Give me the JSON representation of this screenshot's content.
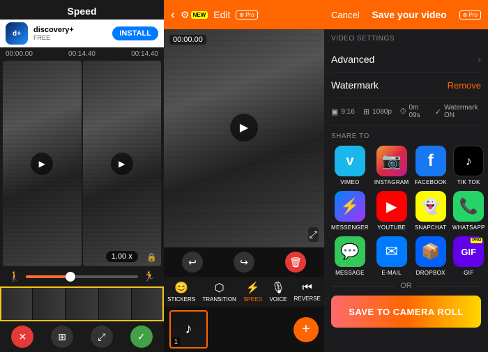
{
  "left": {
    "title": "Speed",
    "ad": {
      "app_name": "discovery+",
      "subtitle": "FREE",
      "install_label": "INSTALL"
    },
    "timeline": {
      "start": "00:00.00",
      "mid": "00:14.40",
      "end": "00:14.40"
    },
    "speed_value": "1.00 x",
    "controls": {
      "undo": "↩",
      "redo": "↪",
      "delete": "🗑",
      "cancel": "✕",
      "confirm": "✓"
    }
  },
  "middle": {
    "nav": {
      "edit_label": "Edit",
      "new_badge": "NEW",
      "pro_label": "⊕ Pro"
    },
    "video": {
      "timestamp": "00:00.00"
    },
    "tools": [
      {
        "id": "stickers",
        "icon": "😊",
        "label": "STICKERS"
      },
      {
        "id": "transition",
        "icon": "⬡",
        "label": "TRANSITION"
      },
      {
        "id": "speed",
        "icon": "🏃",
        "label": "SPEED",
        "active": true
      },
      {
        "id": "voice",
        "icon": "🎙",
        "label": "VOICE"
      },
      {
        "id": "reverse",
        "icon": "⏮",
        "label": "REVERSE"
      }
    ],
    "add_label": "+"
  },
  "right": {
    "nav": {
      "cancel_label": "Cancel",
      "title": "Save your video",
      "pro_badge": "⊕ Pro"
    },
    "video_settings_label": "VIDEO SETTINGS",
    "advanced_label": "Advanced",
    "watermark_label": "Watermark",
    "remove_label": "Remove",
    "meta": {
      "ratio": "9:16",
      "resolution": "1080p",
      "duration": "0m 09s",
      "watermark_on": "Watermark ON"
    },
    "share_to_label": "SHARE TO",
    "share_items": [
      {
        "id": "vimeo",
        "label": "VIMEO",
        "icon": "v"
      },
      {
        "id": "instagram",
        "label": "INSTAGRAM",
        "icon": "📷"
      },
      {
        "id": "facebook",
        "label": "FACEBOOK",
        "icon": "f"
      },
      {
        "id": "tiktok",
        "label": "TIK TOK",
        "icon": "♪"
      },
      {
        "id": "messenger",
        "label": "MESSENGER",
        "icon": "💬"
      },
      {
        "id": "youtube",
        "label": "YOUTUBE",
        "icon": "▶"
      },
      {
        "id": "snapchat",
        "label": "SNAPCHAT",
        "icon": "👻"
      },
      {
        "id": "whatsapp",
        "label": "WHATSAPP",
        "icon": "📞"
      },
      {
        "id": "message",
        "label": "MESSAGE",
        "icon": "💬"
      },
      {
        "id": "email",
        "label": "E-MAIL",
        "icon": "✉"
      },
      {
        "id": "dropbox",
        "label": "DROPBOX",
        "icon": "📦"
      },
      {
        "id": "gif",
        "label": "GIF",
        "icon": "GIF",
        "pro": true
      }
    ],
    "or_label": "OR",
    "save_button_label": "SAVE TO CAMERA ROLL"
  }
}
